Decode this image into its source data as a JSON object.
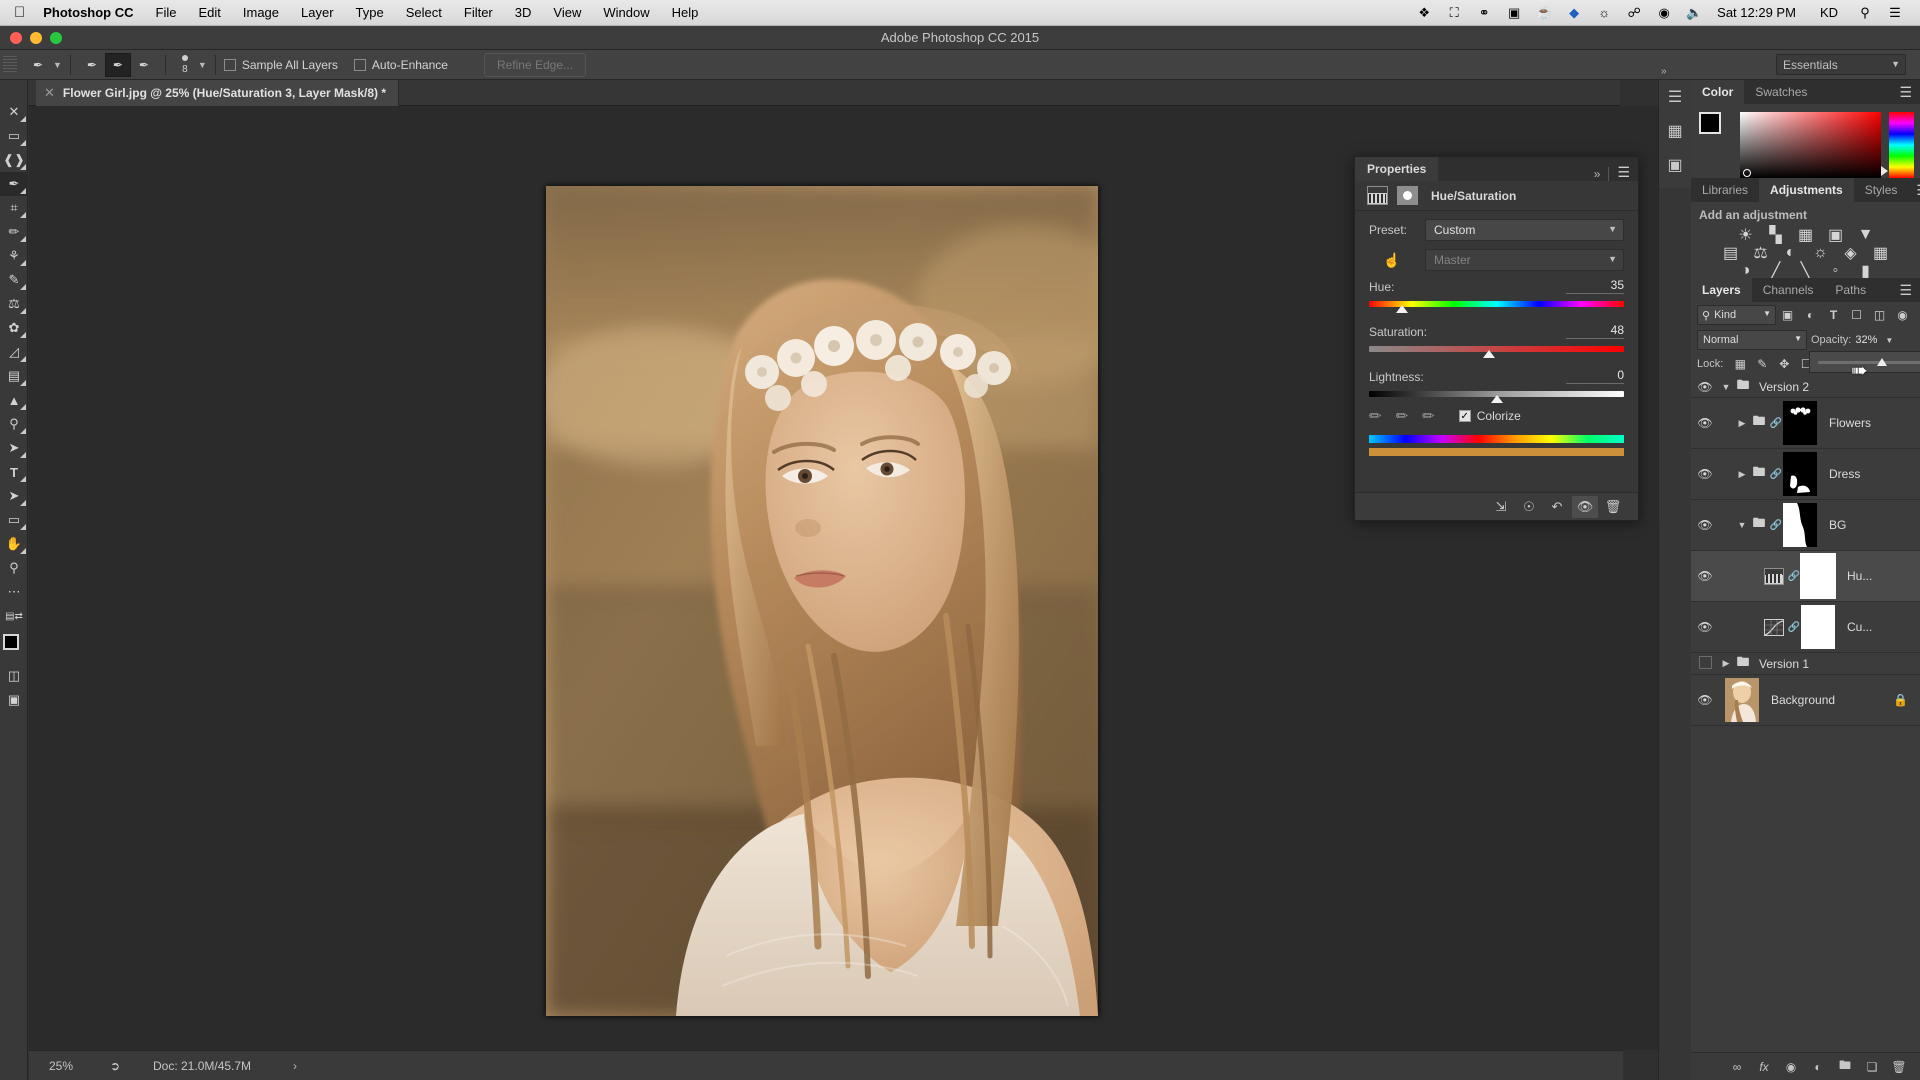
{
  "menubar": {
    "apple_icon": "apple-icon",
    "app_name": "Photoshop CC",
    "items": [
      "File",
      "Edit",
      "Image",
      "Layer",
      "Type",
      "Select",
      "Filter",
      "3D",
      "View",
      "Window",
      "Help"
    ],
    "status_icons": [
      "dropbox-icon",
      "screen-record-icon",
      "creative-cloud-icon",
      "camera-icon",
      "coffee-icon",
      "diamond-icon",
      "binoculars-icon",
      "bluetooth-icon",
      "wifi-icon",
      "volume-icon"
    ],
    "clock": "Sat 12:29 PM",
    "user": "KD",
    "search_icon": "search-icon",
    "notifications_icon": "notification-center-icon"
  },
  "titlebar": {
    "title": "Adobe Photoshop CC 2015",
    "close_color": "#ff5f57",
    "minimize_color": "#febc2e",
    "zoom_color": "#28c840"
  },
  "options_bar": {
    "tool_icon": "quick-selection-tool-icon",
    "mode_new_icon": "selection-new-icon",
    "mode_add_icon": "selection-add-icon",
    "mode_subtract_icon": "selection-subtract-icon",
    "brush_size": "8",
    "sample_all_layers": "Sample All Layers",
    "auto_enhance": "Auto-Enhance",
    "refine_edge": "Refine Edge...",
    "workspace": "Essentials"
  },
  "document_tab": {
    "close_icon": "close-icon",
    "title": "Flower Girl.jpg @ 25% (Hue/Saturation 3, Layer Mask/8) *"
  },
  "toolbar": {
    "tools": [
      {
        "name": "move-tool",
        "glyph": "✥"
      },
      {
        "name": "marquee-tool",
        "glyph": "▭"
      },
      {
        "name": "lasso-tool",
        "glyph": "𝒫"
      },
      {
        "name": "quick-selection-tool",
        "glyph": "✒"
      },
      {
        "name": "crop-tool",
        "glyph": "⌗"
      },
      {
        "name": "eyedropper-tool",
        "glyph": "✎"
      },
      {
        "name": "healing-brush-tool",
        "glyph": "✇"
      },
      {
        "name": "brush-tool",
        "glyph": "🖌"
      },
      {
        "name": "clone-stamp-tool",
        "glyph": "⚱"
      },
      {
        "name": "history-brush-tool",
        "glyph": "❧"
      },
      {
        "name": "eraser-tool",
        "glyph": "◣"
      },
      {
        "name": "gradient-tool",
        "glyph": "▤"
      },
      {
        "name": "blur-tool",
        "glyph": "▲"
      },
      {
        "name": "dodge-tool",
        "glyph": "🔍"
      },
      {
        "name": "pen-tool",
        "glyph": "✐"
      },
      {
        "name": "type-tool",
        "glyph": "T"
      },
      {
        "name": "path-selection-tool",
        "glyph": "➤"
      },
      {
        "name": "rectangle-tool",
        "glyph": "▭"
      },
      {
        "name": "hand-tool",
        "glyph": "✋"
      },
      {
        "name": "zoom-tool",
        "glyph": "⌕"
      },
      {
        "name": "more-tools",
        "glyph": "•••"
      }
    ],
    "foreground_color": "#000000",
    "background_color": "#ffffff",
    "quick-mask-icon": "quick-mask-icon",
    "screen-mode-icon": "screen-mode-icon"
  },
  "properties": {
    "tab": "Properties",
    "collapse_icon": "double-chevron-icon",
    "menu_icon": "panel-menu-icon",
    "adjustment_name": "Hue/Saturation",
    "adjustment_icon": "hue-saturation-icon",
    "mask_icon": "layer-mask-icon",
    "preset_label": "Preset:",
    "preset_value": "Custom",
    "channel_value": "Master",
    "hand_icon": "targeted-adjustment-icon",
    "sliders": [
      {
        "label": "Hue:",
        "value": "35",
        "thumb_pct": 13
      },
      {
        "label": "Saturation:",
        "value": "48",
        "thumb_pct": 47
      },
      {
        "label": "Lightness:",
        "value": "0",
        "thumb_pct": 50
      }
    ],
    "eyedropper_icons": [
      "eyedropper-icon",
      "eyedropper-add-icon",
      "eyedropper-subtract-icon"
    ],
    "colorize_label": "Colorize",
    "colorize_checked": true,
    "footer_icons": [
      "clip-to-layer-icon",
      "view-previous-state-icon",
      "reset-icon",
      "toggle-visibility-icon",
      "delete-icon"
    ]
  },
  "color_panel": {
    "tabs": [
      "Color",
      "Swatches"
    ],
    "active_tab": "Color",
    "menu_icon": "panel-menu-icon",
    "foreground": "#000000",
    "background": "#ffffff"
  },
  "adjustments_panel": {
    "tabs": [
      "Libraries",
      "Adjustments",
      "Styles"
    ],
    "active_tab": "Adjustments",
    "menu_icon": "panel-menu-icon",
    "heading": "Add an adjustment",
    "row1": [
      "brightness-contrast-icon",
      "levels-icon",
      "curves-icon",
      "exposure-icon",
      "vibrance-icon"
    ],
    "row2": [
      "hue-saturation-icon",
      "color-balance-icon",
      "black-white-icon",
      "photo-filter-icon",
      "channel-mixer-icon",
      "color-lookup-icon"
    ],
    "row3": [
      "invert-icon",
      "posterize-icon",
      "threshold-icon",
      "selective-color-icon",
      "gradient-map-icon"
    ]
  },
  "layers_panel": {
    "tabs": [
      "Layers",
      "Channels",
      "Paths"
    ],
    "active_tab": "Layers",
    "menu_icon": "panel-menu-icon",
    "filter_kind": "Kind",
    "filter_search_icon": "search-icon",
    "filter_icons": [
      "pixel-filter-icon",
      "adjustment-filter-icon",
      "type-filter-icon",
      "shape-filter-icon",
      "smart-object-filter-icon"
    ],
    "filter_toggle_icon": "filter-toggle-icon",
    "blend_mode": "Normal",
    "opacity_label": "Opacity:",
    "opacity_value": "32%",
    "lock_label": "Lock:",
    "lock_icons": [
      "lock-transparency-icon",
      "lock-image-icon",
      "lock-position-icon",
      "lock-artboard-icon"
    ],
    "opacity_slider_pct": 32,
    "cursor_icon": "mouse-cursor",
    "layers": [
      {
        "type": "group",
        "name": "Version 2",
        "visible": true,
        "expanded": true,
        "indent": 0
      },
      {
        "type": "layer",
        "name": "Flowers",
        "visible": true,
        "expanded": false,
        "indent": 1,
        "thumb": "mask-flowers",
        "linked": true,
        "folder": true
      },
      {
        "type": "layer",
        "name": "Dress",
        "visible": true,
        "expanded": false,
        "indent": 1,
        "thumb": "mask-dress",
        "linked": true,
        "folder": true
      },
      {
        "type": "layer",
        "name": "BG",
        "visible": true,
        "expanded": true,
        "indent": 1,
        "thumb": "mask-bg",
        "linked": true,
        "folder": true
      },
      {
        "type": "adjustment",
        "name": "Hu...",
        "visible": true,
        "indent": 2,
        "thumb": "white-mask",
        "selected": true,
        "adj_icon": "hue-saturation-icon",
        "linked": true
      },
      {
        "type": "adjustment",
        "name": "Cu...",
        "visible": true,
        "indent": 2,
        "thumb": "white-mask",
        "selected": false,
        "adj_icon": "curves-icon",
        "linked": true
      },
      {
        "type": "group",
        "name": "Version 1",
        "visible": false,
        "expanded": false,
        "indent": 0
      },
      {
        "type": "layer",
        "name": "Background",
        "visible": true,
        "indent": 0,
        "thumb": "photo",
        "locked": true,
        "lock_icon": "lock-icon"
      }
    ],
    "footer_icons": [
      "link-layers-icon",
      "layer-style-icon",
      "layer-mask-icon",
      "adjustment-layer-icon",
      "new-group-icon",
      "new-layer-icon",
      "delete-layer-icon"
    ]
  },
  "icon_dock": {
    "icons": [
      "history-panel-icon",
      "properties-panel-icon",
      "channels-panel-icon"
    ]
  },
  "status_bar": {
    "zoom": "25%",
    "share_icon": "share-icon",
    "doc_info": "Doc: 21.0M/45.7M",
    "expand_icon": "chevron-right-icon"
  },
  "canvas": {
    "image_name": "flower-girl-photo",
    "zoom_level": "25%"
  },
  "colors": {
    "panel_bg": "#3c3c3c",
    "app_bg": "#303030",
    "canvas_bg": "#2b2b2b",
    "accent_text": "#dcdcdc"
  }
}
